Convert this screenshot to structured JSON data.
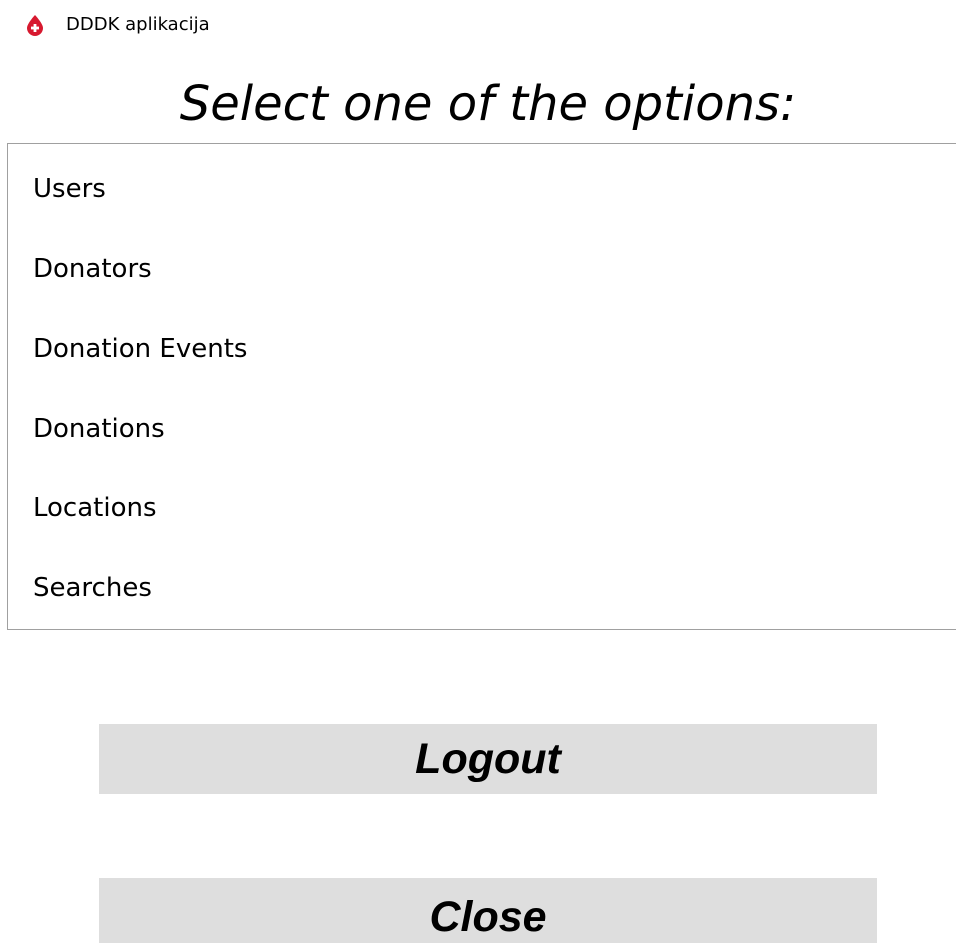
{
  "window": {
    "title": "DDDK aplikacija",
    "icon": "blood-drop-icon",
    "icon_color": "#d7192f"
  },
  "heading": "Select one of the options:",
  "options": [
    {
      "label": "Users"
    },
    {
      "label": "Donators"
    },
    {
      "label": "Donation Events"
    },
    {
      "label": "Donations"
    },
    {
      "label": "Locations"
    },
    {
      "label": "Searches"
    }
  ],
  "buttons": {
    "logout_label": "Logout",
    "close_label": "Close",
    "background": "#dedede"
  }
}
